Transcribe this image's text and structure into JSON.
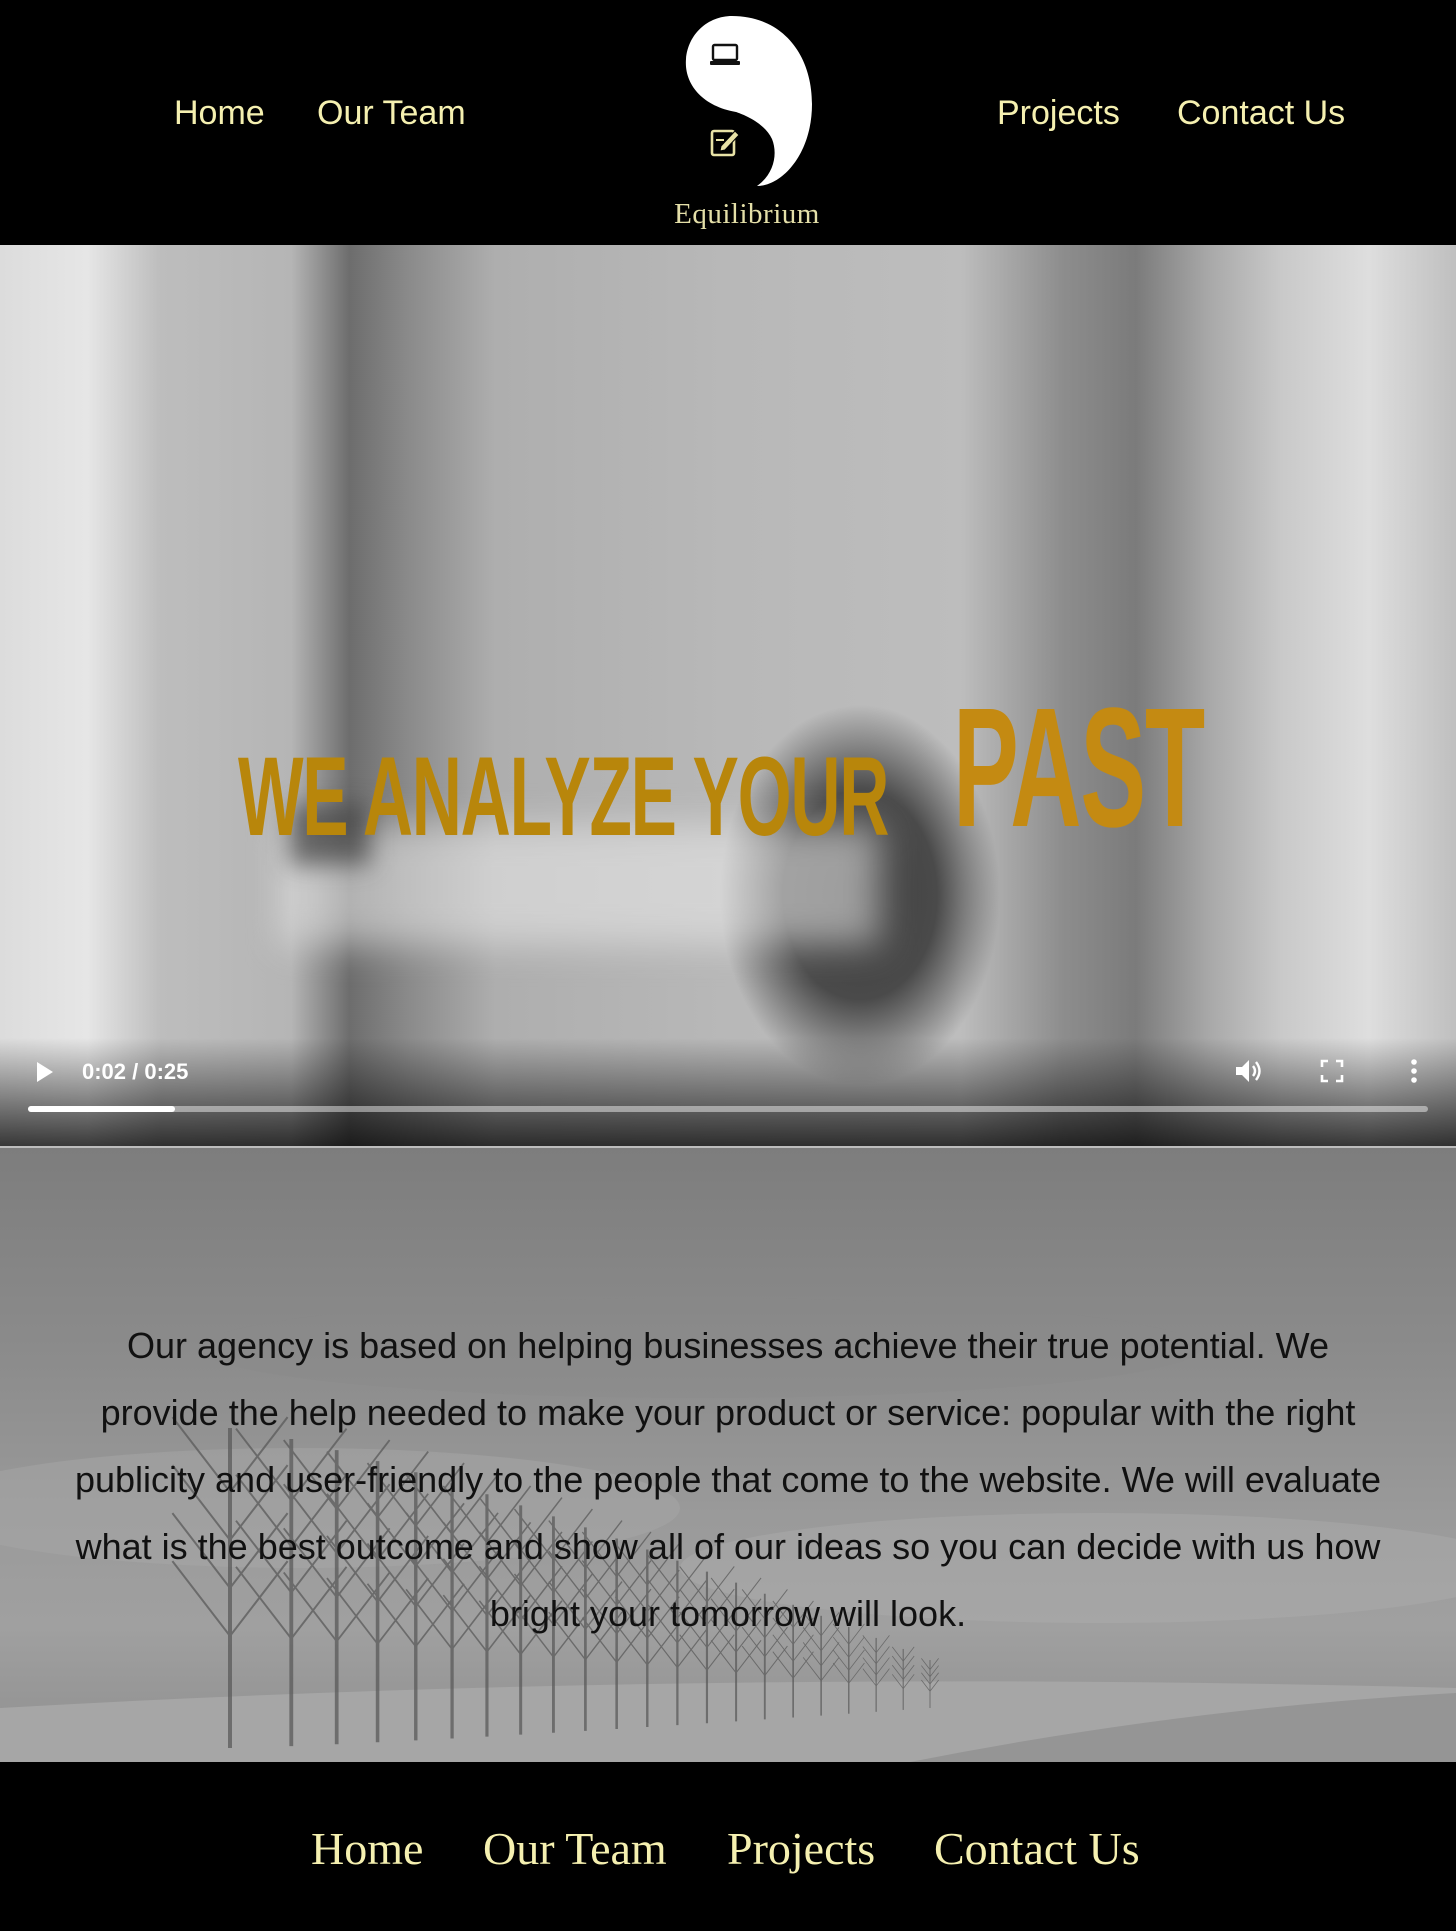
{
  "header": {
    "nav_left": [
      {
        "label": "Home"
      },
      {
        "label": "Our Team"
      }
    ],
    "nav_right": [
      {
        "label": "Projects"
      },
      {
        "label": "Contact Us"
      }
    ],
    "logo": {
      "brand_name": "Equilibrium",
      "icons": [
        "laptop-icon",
        "edit-note-icon"
      ]
    }
  },
  "video": {
    "headline_small": "WE ANALYZE YOUR",
    "headline_big": "PAST",
    "headline_color": "#b8860b",
    "time_display": "0:02 / 0:25",
    "progress_fraction": 0.105,
    "controls": [
      "play-icon",
      "volume-icon",
      "fullscreen-icon",
      "more-options-icon"
    ]
  },
  "about": {
    "text": "Our agency is based on helping businesses achieve their true potential. We provide the help needed to make your product or service: popular with the right publicity and user-friendly to the people that come to the website. We will evaluate what is the best outcome and show all of our ideas so you can decide with us how bright your tomorrow will look."
  },
  "footer": {
    "links": [
      {
        "label": "Home"
      },
      {
        "label": "Our Team"
      },
      {
        "label": "Projects"
      },
      {
        "label": "Contact Us"
      }
    ]
  },
  "colors": {
    "nav_text": "#f5f0b0",
    "background": "#000000",
    "accent_gold": "#c48a12"
  }
}
